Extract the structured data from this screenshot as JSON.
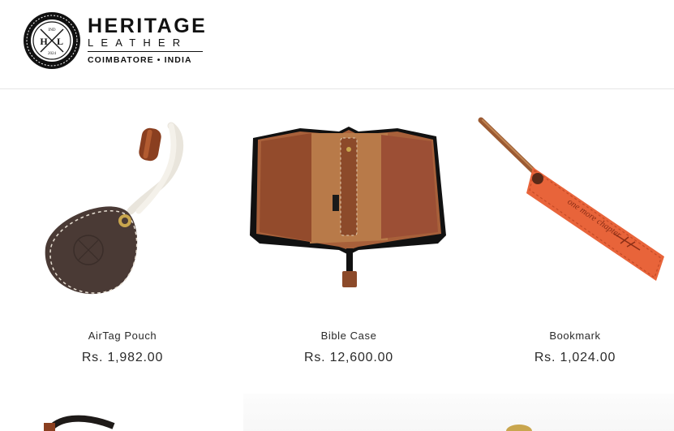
{
  "brand": {
    "name_top": "HERITAGE",
    "name_mid": "LEATHER",
    "location": "COIMBATORE • INDIA",
    "seal_initials_left": "H",
    "seal_initials_right": "L",
    "seal_top": "IND",
    "seal_bottom": "2024"
  },
  "products": [
    {
      "title": "AirTag Pouch",
      "price": "Rs. 1,982.00",
      "icon": "airtag-pouch-image"
    },
    {
      "title": "Bible Case",
      "price": "Rs. 12,600.00",
      "icon": "bible-case-image"
    },
    {
      "title": "Bookmark",
      "price": "Rs. 1,024.00",
      "icon": "bookmark-image"
    }
  ],
  "colors": {
    "dark_leather": "#4a3a35",
    "tan_leather": "#a0582f",
    "orange_leather": "#e8643a",
    "text": "#2a2a2a"
  }
}
